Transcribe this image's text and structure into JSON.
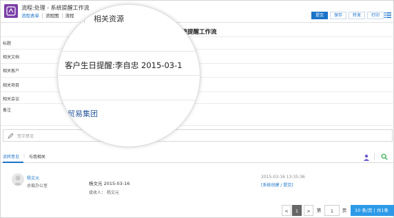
{
  "header": {
    "title": "流程:处理 - 系统提醒工作流",
    "tabs": [
      {
        "label": "流程表单"
      },
      {
        "label": "流程图"
      },
      {
        "label": "流程"
      }
    ],
    "actions": [
      "提交",
      "保存",
      "转发",
      "打印"
    ],
    "colors": {
      "accent": "#1a73c8",
      "app_icon": "#7b3fa8"
    }
  },
  "form": {
    "title": "系统提醒工作流",
    "fields": [
      "标题",
      "相关文档",
      "相关客户",
      "相关项目",
      "相关会议",
      "备注"
    ]
  },
  "magnifier": {
    "tab_label": "相关资源",
    "customer_text": "客户生日提醒:李自忠 2015-03-1",
    "link_text": "贸易集团"
  },
  "opinion": {
    "placeholder": "签字意见"
  },
  "subtabs": {
    "active": "流转意见",
    "other": "与我相关"
  },
  "comment": {
    "name": "杨文元",
    "department": "总裁办公室",
    "body": "杨文元 2015-03-16",
    "receivers": "接收人：  杨文元",
    "time": "2015-03-16    13:35:36",
    "link": "[系统创建 / 提交]"
  },
  "pager": {
    "prev": "<",
    "current": "1",
    "next": ">",
    "page_word": "第",
    "page_value": "1",
    "page_unit": "页",
    "page_size": "10  条/页 | 共1条"
  }
}
